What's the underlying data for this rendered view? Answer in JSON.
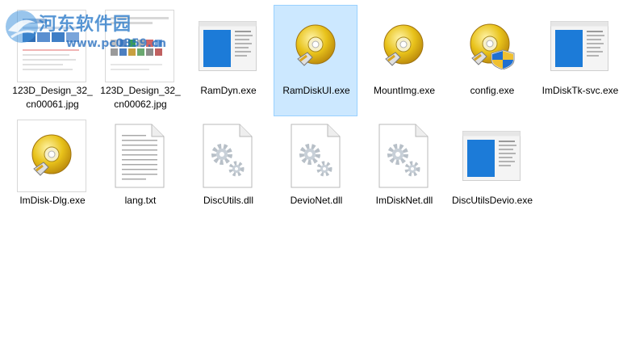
{
  "watermark": {
    "site_name": "河东软件园",
    "site_url": "www.pc0359.cn"
  },
  "files": [
    {
      "name": "123D_Design_32_cn00061.jpg",
      "icon": "image-thumbnail-icon",
      "selected": false
    },
    {
      "name": "123D_Design_32_cn00062.jpg",
      "icon": "image-thumbnail-icon",
      "selected": false
    },
    {
      "name": "RamDyn.exe",
      "icon": "window-app-icon",
      "selected": false
    },
    {
      "name": "RamDiskUI.exe",
      "icon": "disc-app-icon",
      "selected": true
    },
    {
      "name": "MountImg.exe",
      "icon": "disc-app-icon",
      "selected": false
    },
    {
      "name": "config.exe",
      "icon": "disc-shield-app-icon",
      "selected": false
    },
    {
      "name": "ImDiskTk-svc.exe",
      "icon": "window-app-icon",
      "selected": false
    },
    {
      "name": "ImDisk-Dlg.exe",
      "icon": "disc-app-icon",
      "selected": false
    },
    {
      "name": "lang.txt",
      "icon": "text-file-icon",
      "selected": false
    },
    {
      "name": "DiscUtils.dll",
      "icon": "dll-gear-icon",
      "selected": false
    },
    {
      "name": "DevioNet.dll",
      "icon": "dll-gear-icon",
      "selected": false
    },
    {
      "name": "ImDiskNet.dll",
      "icon": "dll-gear-icon",
      "selected": false
    },
    {
      "name": "DiscUtilsDevio.exe",
      "icon": "window-app-icon",
      "selected": false
    }
  ]
}
